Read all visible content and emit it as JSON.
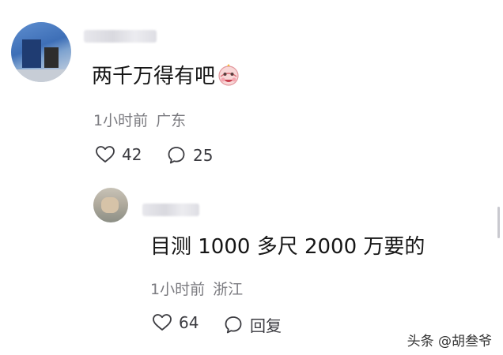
{
  "comment": {
    "avatar_icon": "user-avatar",
    "text": "两千万得有吧",
    "emoji_icon": "crying-laughing-face-icon",
    "time": "1小时前",
    "location": "广东",
    "likes": "42",
    "replies": "25",
    "like_icon": "heart-icon",
    "reply_icon": "speech-bubble-icon"
  },
  "reply": {
    "avatar_icon": "user-avatar",
    "text": "目测 1000 多尺 2000 万要的",
    "time": "1小时前",
    "location": "浙江",
    "likes": "64",
    "reply_label": "回复",
    "like_icon": "heart-icon",
    "reply_icon": "speech-bubble-icon"
  },
  "watermark": "头条 @胡叁爷",
  "colors": {
    "background": "#ffffff",
    "text": "#161616",
    "meta": "#7b7b80",
    "action": "#3b3b40"
  }
}
